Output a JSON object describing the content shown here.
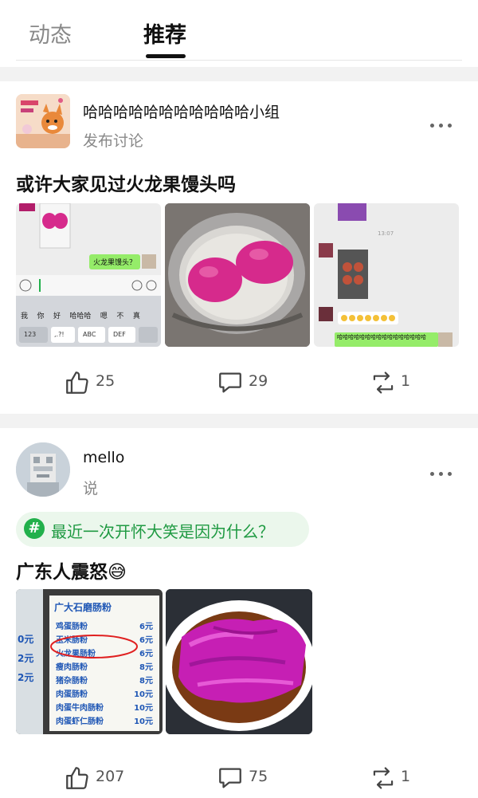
{
  "tabs": [
    {
      "label": "动态",
      "active": false
    },
    {
      "label": "推荐",
      "active": true
    }
  ],
  "post1": {
    "group_name": "哈哈哈哈哈哈哈哈哈哈哈小组",
    "subtitle": "发布讨论",
    "title": "或许大家见过火龙果馒头吗",
    "chat1": {
      "bubble": "火龙果馒头？",
      "keys": [
        "我",
        "你",
        "好",
        "哈哈哈",
        "嗯",
        "不",
        "真"
      ],
      "row2": [
        "123",
        ",.?!",
        "ABC",
        "DEF"
      ]
    },
    "chat3": {
      "time": "13:07",
      "reply": "哈哈哈哈哈哈哈哈哈哈哈哈哈哈哈哈"
    },
    "likes": "25",
    "comments": "29",
    "reposts": "1"
  },
  "post2": {
    "username": "mello",
    "subtitle": "说",
    "topic": "最近一次开怀大笑是因为什么？",
    "title": "广东人震怒😅",
    "menu": {
      "header": "广大石磨肠粉",
      "items": [
        {
          "name": "鸡蛋肠粉",
          "price": "6元"
        },
        {
          "name": "玉米肠粉",
          "price": "6元"
        },
        {
          "name": "火龙果肠粉",
          "price": "6元"
        },
        {
          "name": "瘦肉肠粉",
          "price": "8元"
        },
        {
          "name": "猪杂肠粉",
          "price": "8元"
        },
        {
          "name": "肉蛋肠粉",
          "price": "10元"
        },
        {
          "name": "肉蛋牛肉肠粉",
          "price": "10元"
        },
        {
          "name": "肉蛋虾仁肠粉",
          "price": "10元"
        }
      ],
      "side_prices": [
        "0元",
        "2元",
        "2元"
      ]
    },
    "likes": "207",
    "comments": "75",
    "reposts": "1"
  },
  "colors": {
    "accent_green": "#21b04b",
    "topic_bg": "#ebf7ec",
    "dragonfruit": "#d62a8c"
  },
  "icons": [
    "thumbs-up-icon",
    "comment-icon",
    "repost-icon",
    "more-icon",
    "hashtag-icon"
  ]
}
